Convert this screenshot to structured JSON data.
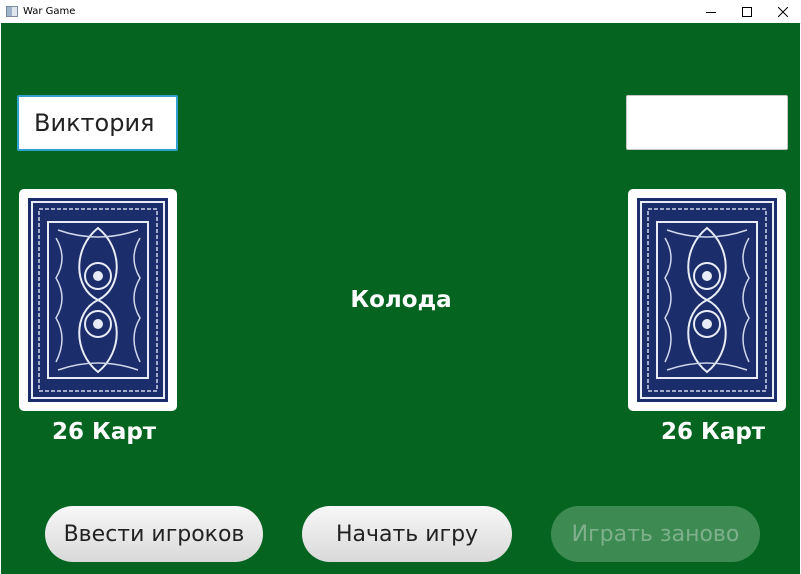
{
  "window": {
    "title": "War Game",
    "controls": [
      "minimize-icon",
      "maximize-icon",
      "close-icon"
    ]
  },
  "colors": {
    "table": "#056520",
    "card_back": "#1c2d6b",
    "focus_border": "#2fa0cf"
  },
  "players": {
    "left": {
      "name_value": "Виктория",
      "card_count": "26 Карт"
    },
    "right": {
      "name_value": "",
      "card_count": "26 Карт"
    }
  },
  "deck_label": "Колода",
  "buttons": {
    "enter_players": "Ввести игроков",
    "start_game": "Начать игру",
    "play_again": "Играть заново"
  }
}
